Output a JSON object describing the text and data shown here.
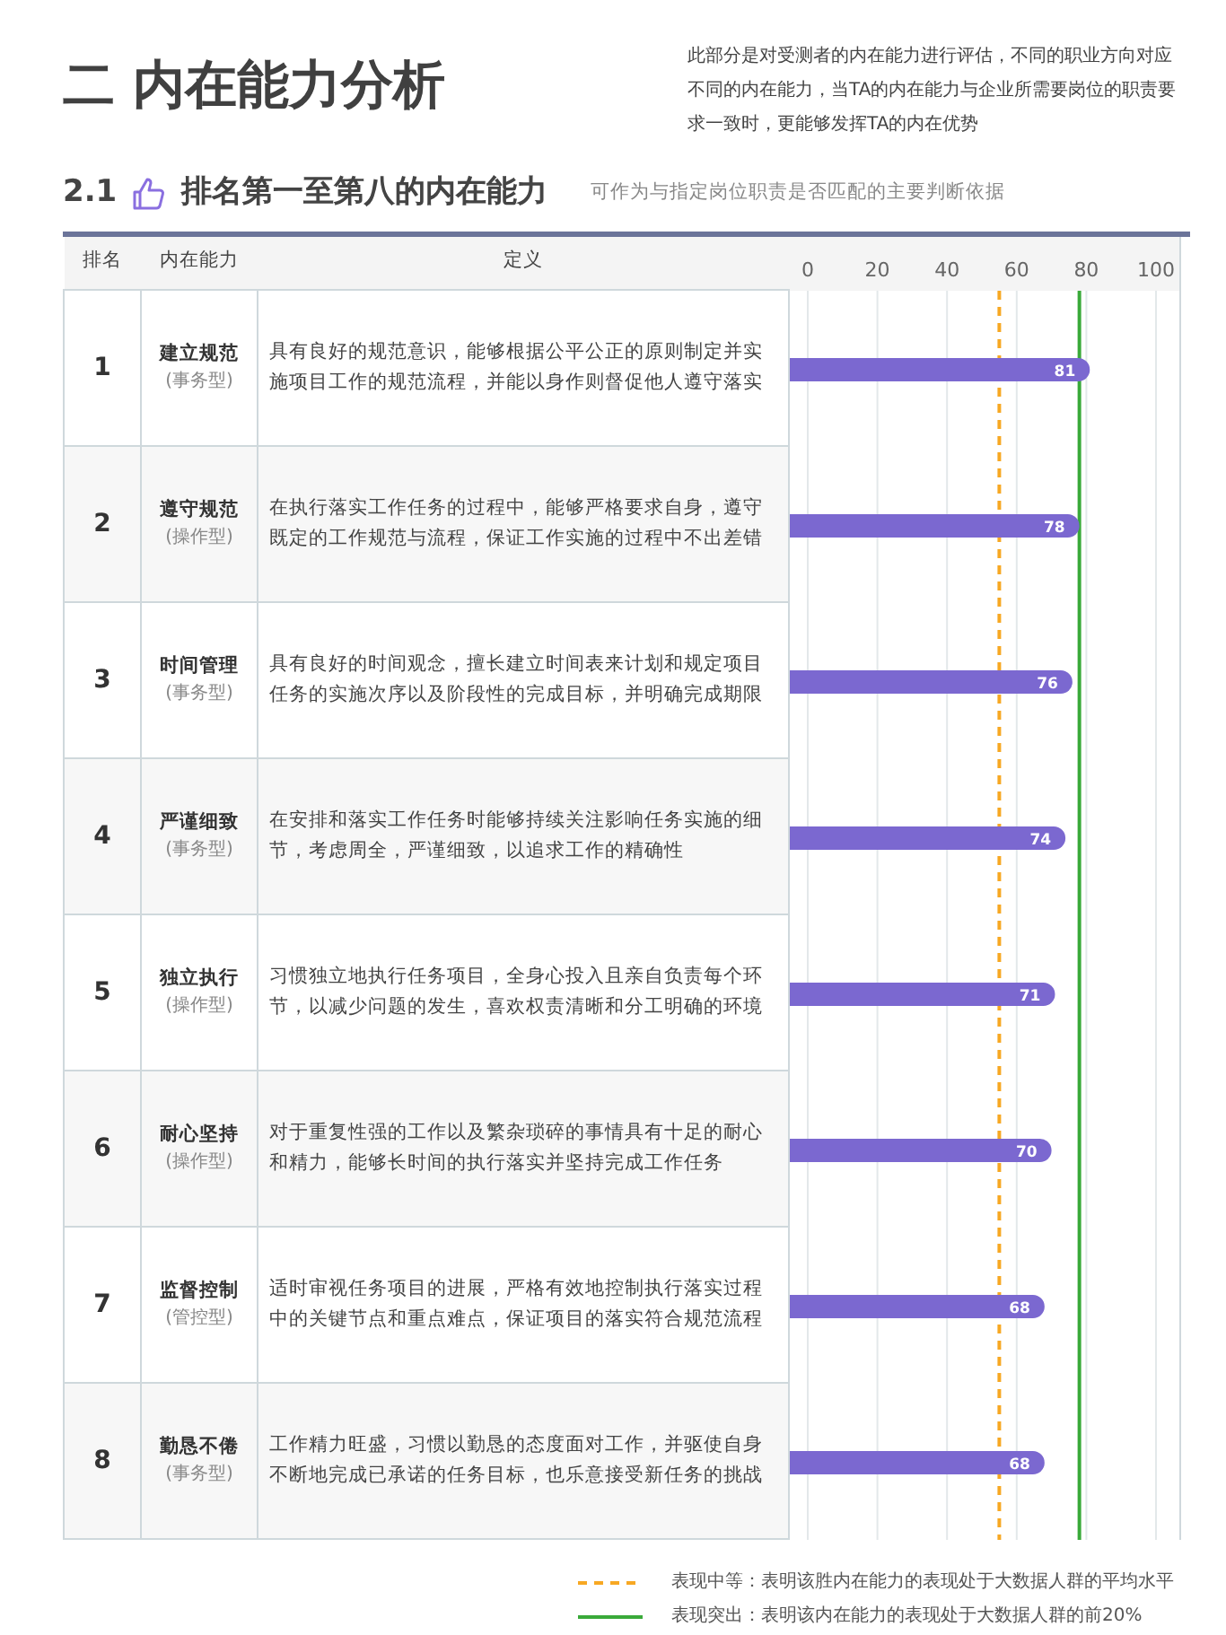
{
  "header": {
    "title": "二 内在能力分析",
    "intro": "此部分是对受测者的内在能力进行评估，不同的职业方向对应不同的内在能力，当TA的内在能力与企业所需要岗位的职责要求一致时，更能够发挥TA的内在优势"
  },
  "section": {
    "number": "2.1",
    "title": "排名第一至第八的内在能力",
    "subtitle": "可作为与指定岗位职责是否匹配的主要判断依据"
  },
  "table": {
    "columns": [
      "排名",
      "内在能力",
      "定义"
    ],
    "rows": [
      {
        "rank": "1",
        "ability": "建立规范",
        "type": "(事务型)",
        "definition": "具有良好的规范意识，能够根据公平公正的原则制定并实施项目工作的规范流程，并能以身作则督促他人遵守落实"
      },
      {
        "rank": "2",
        "ability": "遵守规范",
        "type": "(操作型)",
        "definition": "在执行落实工作任务的过程中，能够严格要求自身，遵守既定的工作规范与流程，保证工作实施的过程中不出差错"
      },
      {
        "rank": "3",
        "ability": "时间管理",
        "type": "(事务型)",
        "definition": "具有良好的时间观念，擅长建立时间表来计划和规定项目任务的实施次序以及阶段性的完成目标，并明确完成期限"
      },
      {
        "rank": "4",
        "ability": "严谨细致",
        "type": "(事务型)",
        "definition": "在安排和落实工作任务时能够持续关注影响任务实施的细节，考虑周全，严谨细致，以追求工作的精确性"
      },
      {
        "rank": "5",
        "ability": "独立执行",
        "type": "(操作型)",
        "definition": "习惯独立地执行任务项目，全身心投入且亲自负责每个环节，以减少问题的发生，喜欢权责清晰和分工明确的环境"
      },
      {
        "rank": "6",
        "ability": "耐心坚持",
        "type": "(操作型)",
        "definition": "对于重复性强的工作以及繁杂琐碎的事情具有十足的耐心和精力，能够长时间的执行落实并坚持完成工作任务"
      },
      {
        "rank": "7",
        "ability": "监督控制",
        "type": "(管控型)",
        "definition": "适时审视任务项目的进展，严格有效地控制执行落实过程中的关键节点和重点难点，保证项目的落实符合规范流程"
      },
      {
        "rank": "8",
        "ability": "勤恳不倦",
        "type": "(事务型)",
        "definition": "工作精力旺盛，习惯以勤恳的态度面对工作，并驱使自身不断地完成已承诺的任务目标，也乐意接受新任务的挑战"
      }
    ],
    "chart_data": {
      "type": "bar",
      "orientation": "horizontal",
      "values": [
        81,
        78,
        76,
        74,
        71,
        70,
        68,
        68
      ],
      "xlim": [
        0,
        100
      ],
      "xticks": [
        0,
        20,
        40,
        60,
        80,
        100
      ],
      "data_labels": true,
      "grid": true,
      "ref_lines": [
        {
          "axis": "x",
          "value": 55,
          "color": "#f7a823"
        },
        {
          "axis": "x",
          "value": 78,
          "color": "#3aaa3a"
        }
      ]
    }
  },
  "legend": [
    {
      "kind": "dashed",
      "color": "#f7a823",
      "text": "表现中等：表明该胜内在能力的表现处于大数据人群的平均水平"
    },
    {
      "kind": "solid",
      "color": "#3aaa3a",
      "text": "表现突出：表明该内在能力的表现处于大数据人群的前20%"
    }
  ]
}
